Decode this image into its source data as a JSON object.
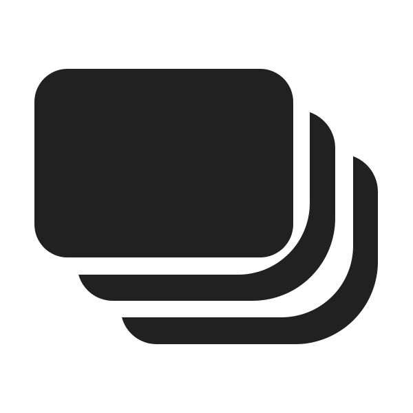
{
  "icon": {
    "name": "stacked-cards-icon",
    "layers": [
      "front-card",
      "middle-card",
      "back-card"
    ]
  },
  "colors": {
    "background": "#ffffff",
    "fill": "#212121"
  }
}
